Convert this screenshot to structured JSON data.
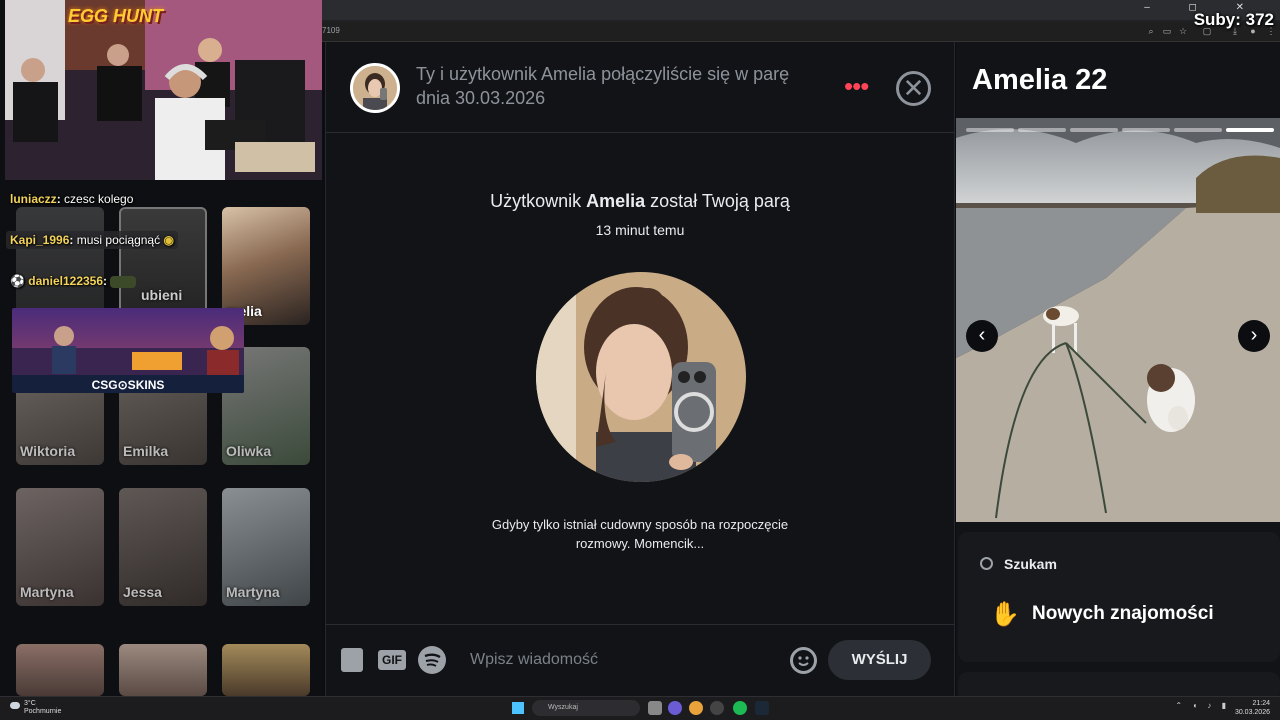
{
  "overlay": {
    "subs": "Suby: 372",
    "window_controls": "– ◻ ✕"
  },
  "browser": {
    "url_fragment": "7109"
  },
  "chat_overlay": [
    {
      "user": "luniaczz",
      "text": "czesc kolego"
    },
    {
      "user": "Kapi_1996",
      "text": "musi pociągnąć"
    },
    {
      "user": "daniel122356",
      "text": ""
    }
  ],
  "banner": {
    "title": "EGG HUNT",
    "sponsor": "CSG⊙SKINS"
  },
  "grid": {
    "tiles": [
      {
        "name": "Wiktoria"
      },
      {
        "name": "Emilka"
      },
      {
        "name": "Oliwka"
      },
      {
        "name": "Martyna"
      },
      {
        "name": "Jessa"
      },
      {
        "name": "Martyna"
      }
    ],
    "featured_partial": "melia",
    "likes_partial": "ubieni"
  },
  "conversation": {
    "header_text": "Ty i użytkownik Amelia połączyliście się w parę dnia 30.03.2026",
    "match_prefix": "Użytkownik",
    "match_name": "Amelia",
    "match_suffix": "został Twoją parą",
    "match_time": "13 minut temu",
    "prompt": "Gdyby tylko istniał cudowny sposób na rozpoczęcie rozmowy. Momencik...",
    "gif_label": "GIF",
    "input_placeholder": "Wpisz wiadomość",
    "send_label": "WYŚLIJ",
    "more_dots": "•••",
    "close_glyph": "✕"
  },
  "profile": {
    "name_age": "Amelia 22",
    "photo_count": 6,
    "current_photo": 6,
    "looking_label": "Szukam",
    "looking_value": "Nowych znajomości",
    "prev_glyph": "‹",
    "next_glyph": "›"
  },
  "taskbar": {
    "weather_temp": "3°C",
    "weather_desc": "Pochmurnie",
    "search_placeholder": "Wyszukaj",
    "time": "21:24",
    "date": "30.03.2026"
  },
  "colors": {
    "accent": "#ff4458",
    "panel": "#111317",
    "username": "#f3d35a"
  }
}
